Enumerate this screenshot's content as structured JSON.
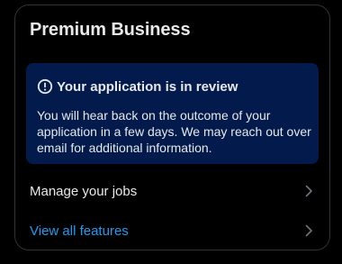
{
  "card": {
    "title": "Premium Business"
  },
  "notice": {
    "icon": "alert-circle-icon",
    "heading": "Your application is in review",
    "body": "You will hear back on the outcome of your application in a few days. We may reach out over email for additional information."
  },
  "rows": {
    "jobs": {
      "label": "Manage your jobs",
      "icon": "chevron-right-icon"
    },
    "features": {
      "label": "View all features",
      "icon": "chevron-right-icon"
    }
  },
  "colors": {
    "background": "#000000",
    "notice_bg": "#031a4d",
    "text": "#e7e9ea",
    "link": "#1d9bf0",
    "border": "#2f3336",
    "chevron": "#71767b"
  }
}
